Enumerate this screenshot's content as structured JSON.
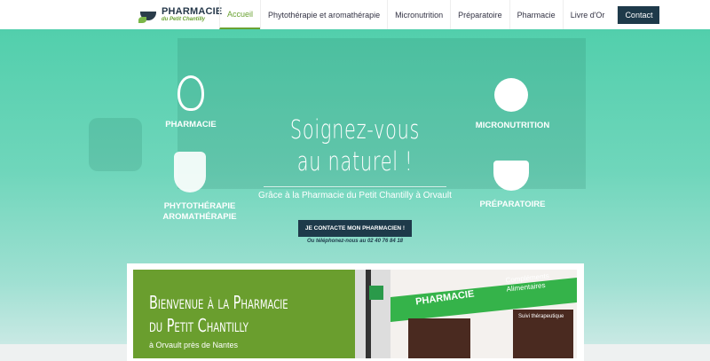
{
  "nav": {
    "logo_title": "PHARMACIE",
    "logo_subtitle": "du Petit Chantilly",
    "items": [
      {
        "label": "Accueil"
      },
      {
        "label": "Phytothérapie et aromathérapie"
      },
      {
        "label": "Micronutrition"
      },
      {
        "label": "Préparatoire"
      },
      {
        "label": "Pharmacie"
      },
      {
        "label": "Livre d'Or"
      }
    ],
    "contact": "Contact"
  },
  "hero": {
    "title_l1": "Soignez-vous",
    "title_l2": "au naturel !",
    "subtitle": "Grâce à la Pharmacie du Petit Chantilly à Orvault",
    "cta": "JE CONTACTE MON PHARMACIEN !",
    "phone_text": "Ou téléphonez-nous au 02 40 76 84 18",
    "categories": {
      "pharmacie": "PHARMACIE",
      "phyto_l1": "PHYTOTHÉRAPIE",
      "phyto_l2": "AROMATHÉRAPIE",
      "micro": "MICRONUTRITION",
      "prep": "PRÉPARATOIRE"
    }
  },
  "welcome": {
    "title_l1": "Bienvenue à la Pharmacie",
    "title_l2": "du Petit Chantilly",
    "subtitle": "à Orvault près de Nantes",
    "photo": {
      "sign": "PHARMACIE",
      "sign2": "Compléments Alimentaires",
      "sign3": "Suivi thérapeutique"
    }
  }
}
